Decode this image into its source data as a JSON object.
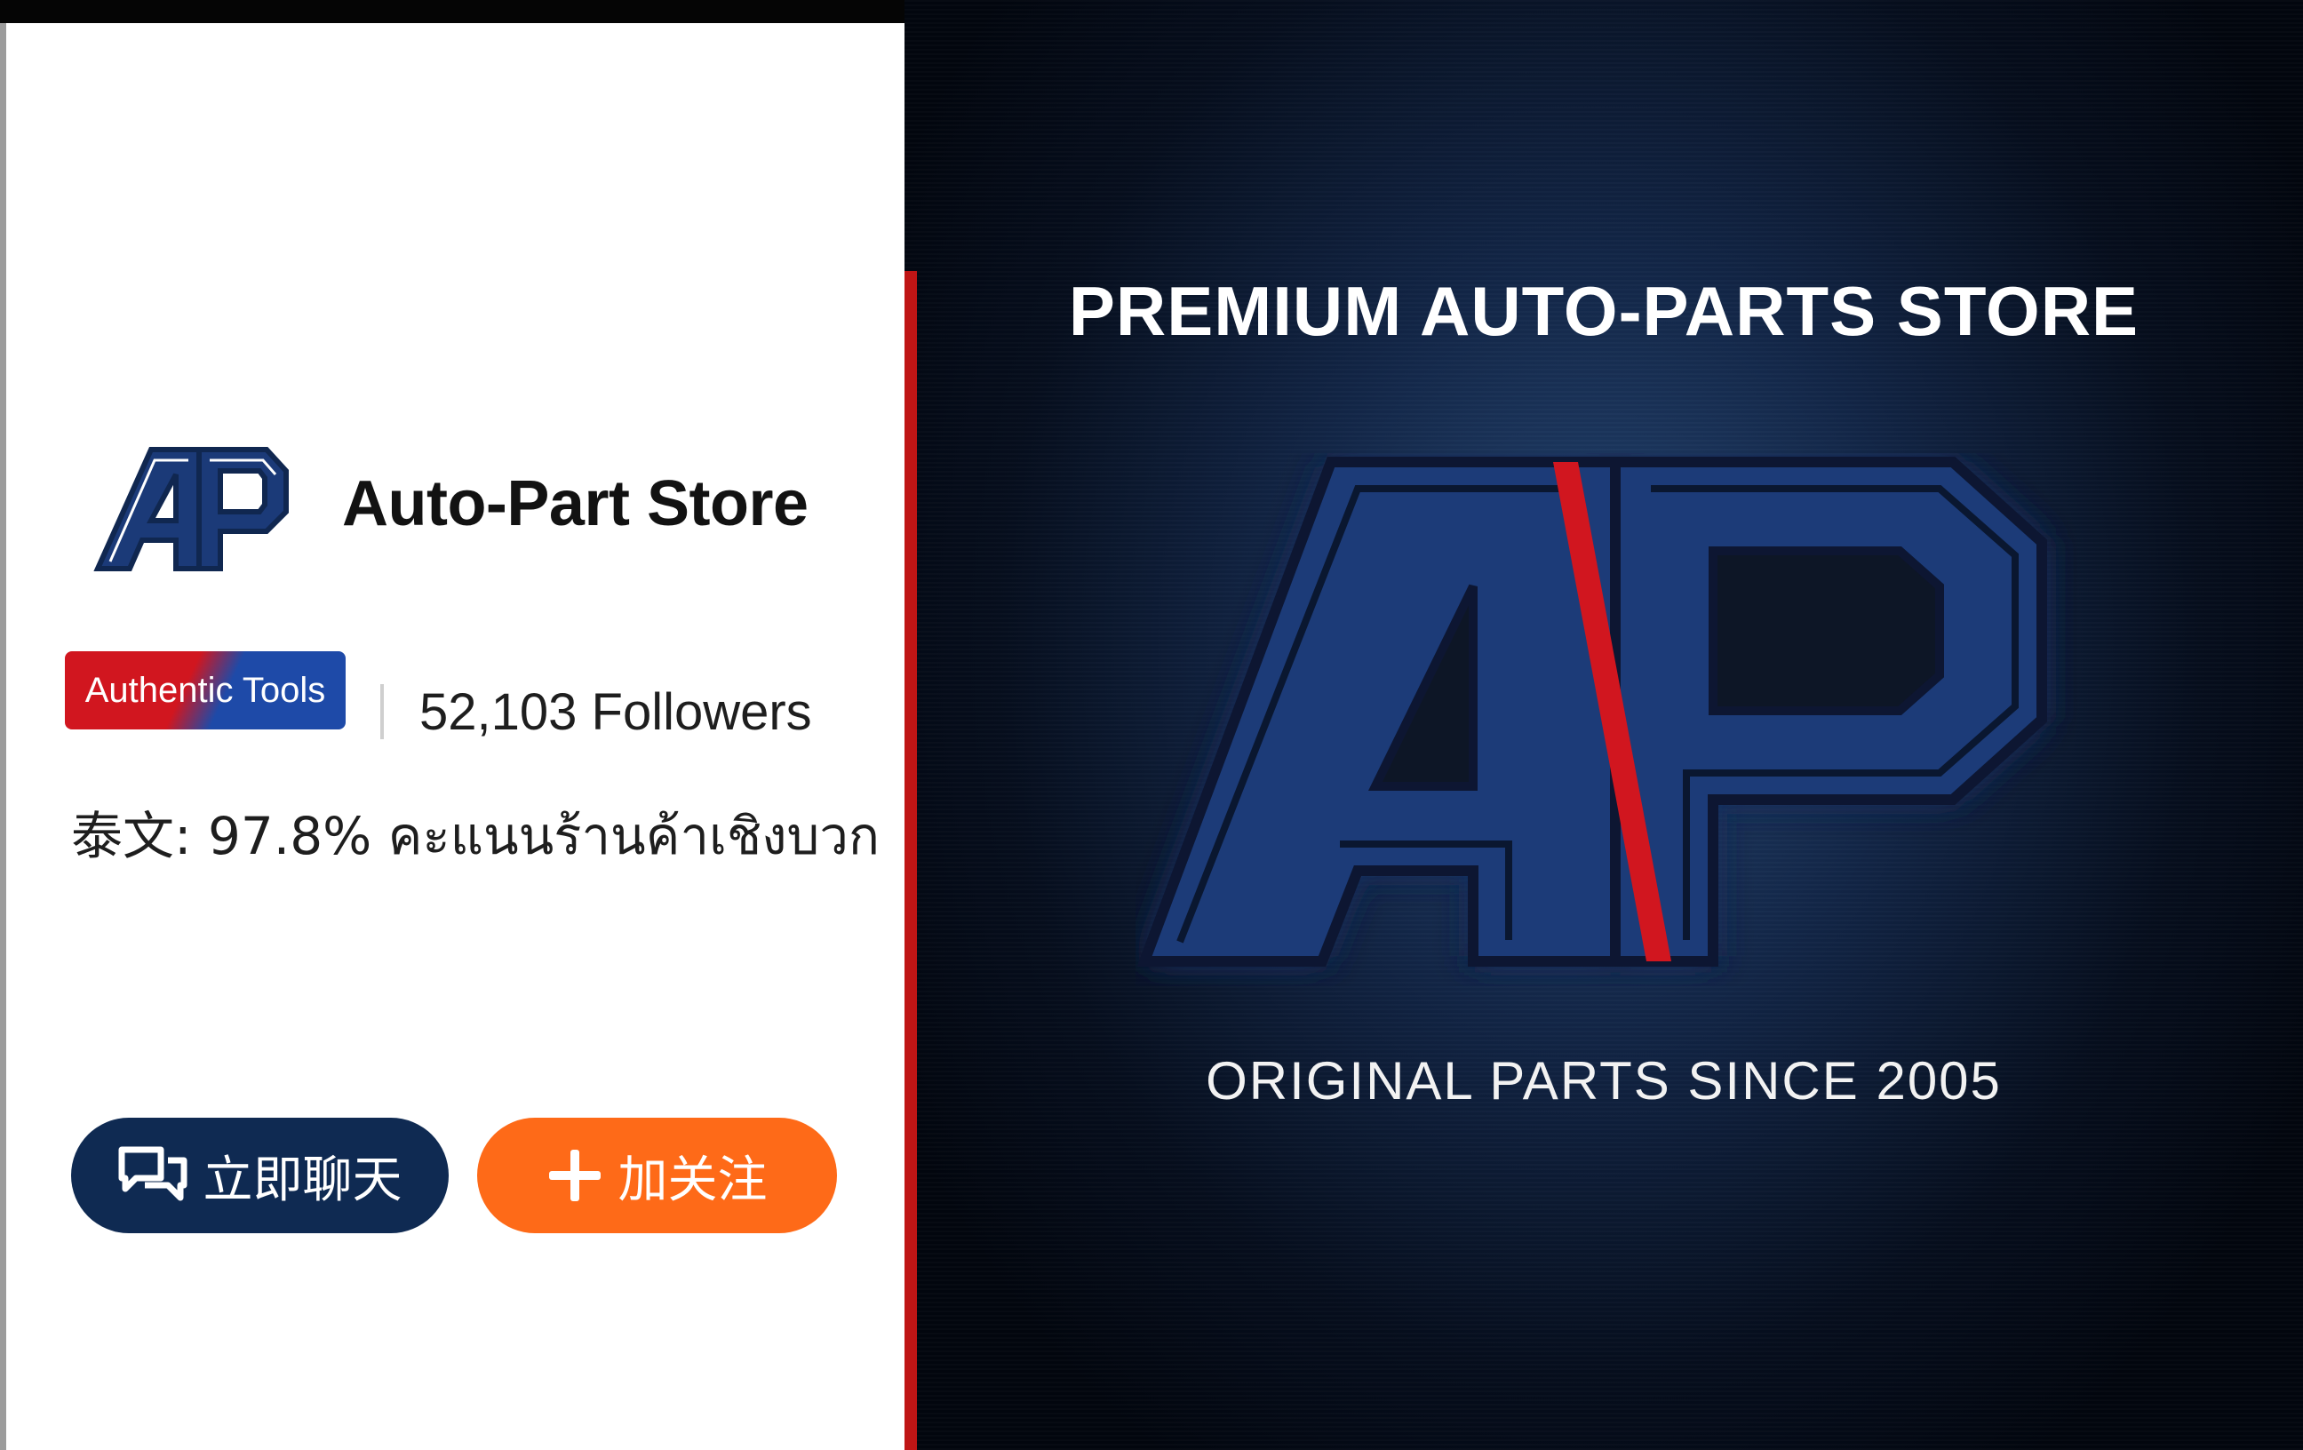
{
  "store": {
    "logo_text": "AP",
    "name": "Auto-Part Store",
    "badge": "Authentic Tools",
    "followers": "52,103 Followers",
    "rating": "泰文: 97.8% คะแนนร้านค้าเชิงบวก"
  },
  "actions": {
    "chat_label": "立即聊天",
    "chat_icon": "chat-bubbles-icon",
    "follow_label": "加关注",
    "follow_icon": "plus-icon"
  },
  "banner": {
    "title": "PREMIUM AUTO-PARTS STORE",
    "logo_text": "AP",
    "subtitle": "ORIGINAL PARTS SINCE 2005"
  },
  "colors": {
    "navy": "#0f2a52",
    "logo_blue": "#1b3a78",
    "orange": "#fe6a18",
    "red": "#d1161f",
    "badge_blue": "#1e4aa8"
  }
}
